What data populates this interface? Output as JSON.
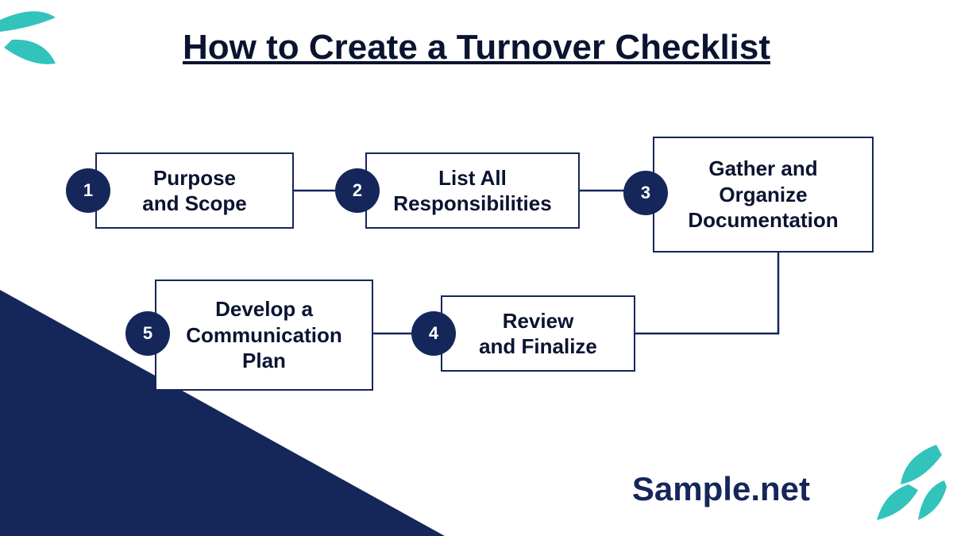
{
  "title": "How to Create a Turnover Checklist",
  "brand": "Sample.net",
  "steps": {
    "s1": {
      "num": "1",
      "label": "Purpose\nand Scope"
    },
    "s2": {
      "num": "2",
      "label": "List All\nResponsibilities"
    },
    "s3": {
      "num": "3",
      "label": "Gather and\nOrganize\nDocumentation"
    },
    "s4": {
      "num": "4",
      "label": "Review\nand Finalize"
    },
    "s5": {
      "num": "5",
      "label": "Develop a\nCommunication\nPlan"
    }
  },
  "colors": {
    "navy": "#15265a",
    "teal": "#32c3bd",
    "text": "#0a1430"
  }
}
